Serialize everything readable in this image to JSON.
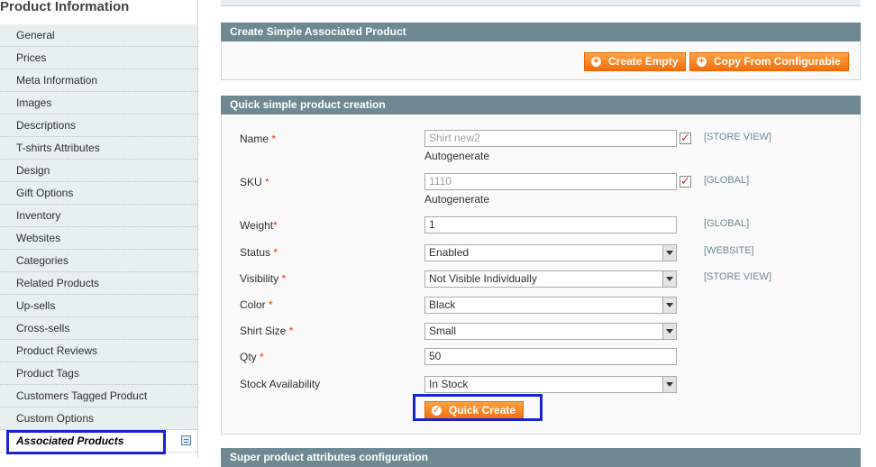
{
  "sidebar": {
    "title": "Product Information",
    "items": [
      {
        "label": "General"
      },
      {
        "label": "Prices"
      },
      {
        "label": "Meta Information"
      },
      {
        "label": "Images"
      },
      {
        "label": "Descriptions"
      },
      {
        "label": "T-shirts Attributes"
      },
      {
        "label": "Design"
      },
      {
        "label": "Gift Options"
      },
      {
        "label": "Inventory"
      },
      {
        "label": "Websites"
      },
      {
        "label": "Categories"
      },
      {
        "label": "Related Products"
      },
      {
        "label": "Up-sells"
      },
      {
        "label": "Cross-sells"
      },
      {
        "label": "Product Reviews"
      },
      {
        "label": "Product Tags"
      },
      {
        "label": "Customers Tagged Product"
      },
      {
        "label": "Custom Options"
      },
      {
        "label": "Associated Products"
      }
    ]
  },
  "create_simple": {
    "title": "Create Simple Associated Product",
    "create_empty_label": "Create Empty",
    "copy_from_configurable_label": "Copy From Configurable"
  },
  "quick_create": {
    "title": "Quick simple product creation",
    "name": {
      "label": "Name",
      "req": "*",
      "value": "Shirt new2",
      "autogenerate": "Autogenerate",
      "scope": "[STORE VIEW]"
    },
    "sku": {
      "label": "SKU",
      "req": "*",
      "value": "1110",
      "autogenerate": "Autogenerate",
      "scope": "[GLOBAL]"
    },
    "weight": {
      "label": "Weight",
      "req": "*",
      "value": "1",
      "scope": "[GLOBAL]"
    },
    "status": {
      "label": "Status",
      "req": "*",
      "value": "Enabled",
      "scope": "[WEBSITE]"
    },
    "visibility": {
      "label": "Visibility",
      "req": "*",
      "value": "Not Visible Individually",
      "scope": "[STORE VIEW]"
    },
    "color": {
      "label": "Color",
      "req": "*",
      "value": "Black"
    },
    "shirt_size": {
      "label": "Shirt Size",
      "req": "*",
      "value": "Small"
    },
    "qty": {
      "label": "Qty",
      "req": "*",
      "value": "50"
    },
    "stock": {
      "label": "Stock Availability",
      "value": "In Stock"
    },
    "button_label": "Quick Create"
  },
  "super_attributes": {
    "title": "Super product attributes configuration"
  },
  "colors": {
    "header_bg": "#6f8992",
    "button_orange": "#f36f0c",
    "highlight_blue": "#1a22d4",
    "required_red": "#eb340a"
  }
}
